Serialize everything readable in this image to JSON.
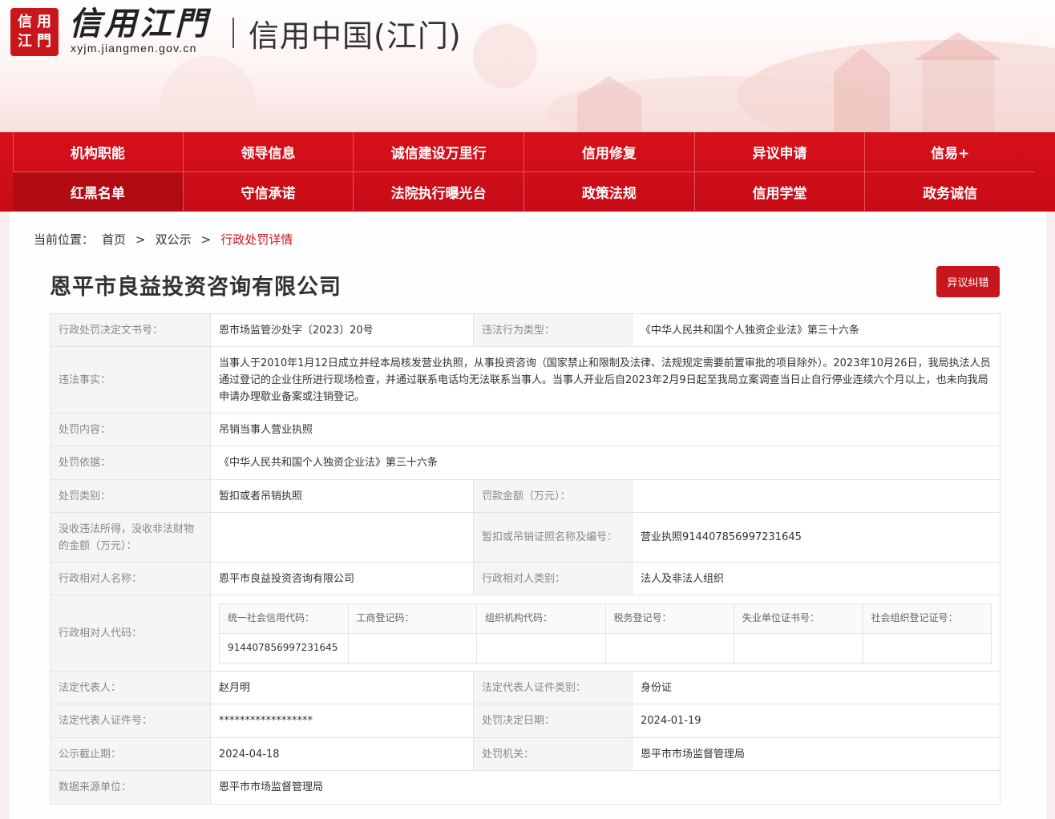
{
  "header": {
    "logo_seal_chars": [
      "信",
      "用",
      "江",
      "門"
    ],
    "logo_name": "信用江門",
    "logo_domain": "xyjm.jiangmen.gov.cn",
    "site_title": "信用中国(江门)"
  },
  "nav": {
    "row1": [
      "机构职能",
      "领导信息",
      "诚信建设万里行",
      "信用修复",
      "异议申请",
      "信易+"
    ],
    "row2": [
      "红黑名单",
      "守信承诺",
      "法院执行曝光台",
      "政策法规",
      "信用学堂",
      "政务诚信"
    ],
    "active": "红黑名单"
  },
  "breadcrumb": {
    "lead": "当前位置：",
    "home": "首页",
    "sep": ">",
    "section": "双公示",
    "current": "行政处罚详情"
  },
  "company_title": "恩平市良益投资咨询有限公司",
  "objection_button": "异议纠错",
  "detail": {
    "decision_no_label": "行政处罚决定文书号：",
    "decision_no": "恩市场监管沙处字〔2023〕20号",
    "violation_type_label": "违法行为类型：",
    "violation_type": "《中华人民共和国个人独资企业法》第三十六条",
    "facts_label": "违法事实：",
    "facts": "当事人于2010年1月12日成立并经本局核发营业执照，从事投资咨询（国家禁止和限制及法律、法规规定需要前置审批的项目除外）。2023年10月26日，我局执法人员通过登记的企业住所进行现场检查，并通过联系电话均无法联系当事人。当事人开业后自2023年2月9日起至我局立案调查当日止自行停业连续六个月以上，也未向我局申请办理歇业备案或注销登记。",
    "content_label": "处罚内容：",
    "content": "吊销当事人营业执照",
    "basis_label": "处罚依据：",
    "basis": "《中华人民共和国个人独资企业法》第三十六条",
    "category_label": "处罚类别：",
    "category": "暂扣或者吊销执照",
    "fine_label": "罚款金额（万元）：",
    "fine": "",
    "confiscation_label": "没收违法所得，没收非法财物的金额（万元）：",
    "confiscation": "",
    "license_label": "暂扣或吊销证照名称及编号：",
    "license": "营业执照914407856997231645",
    "party_name_label": "行政相对人名称：",
    "party_name": "恩平市良益投资咨询有限公司",
    "party_type_label": "行政相对人类别：",
    "party_type": "法人及非法人组织",
    "party_code_label": "行政相对人代码：",
    "codes_headers": [
      "统一社会信用代码：",
      "工商登记码：",
      "组织机构代码：",
      "税务登记号：",
      "失业单位证书号：",
      "社会组织登记证号："
    ],
    "codes_values": [
      "914407856997231645",
      "",
      "",
      "",
      "",
      ""
    ],
    "legal_rep_label": "法定代表人：",
    "legal_rep": "赵月明",
    "legal_rep_id_type_label": "法定代表人证件类别：",
    "legal_rep_id_type": "身份证",
    "legal_rep_id_no_label": "法定代表人证件号：",
    "legal_rep_id_no": "******************",
    "decision_date_label": "处罚决定日期：",
    "decision_date": "2024-01-19",
    "publish_end_label": "公示截止期：",
    "publish_end": "2024-04-18",
    "authority_label": "处罚机关：",
    "authority": "恩平市市场监督管理局",
    "source_label": "数据来源单位：",
    "source": "恩平市市场监督管理局"
  },
  "colors": {
    "brand_red": "#c8161d",
    "nav_red": "#d8101b",
    "label_bg": "#f5f5f5"
  }
}
